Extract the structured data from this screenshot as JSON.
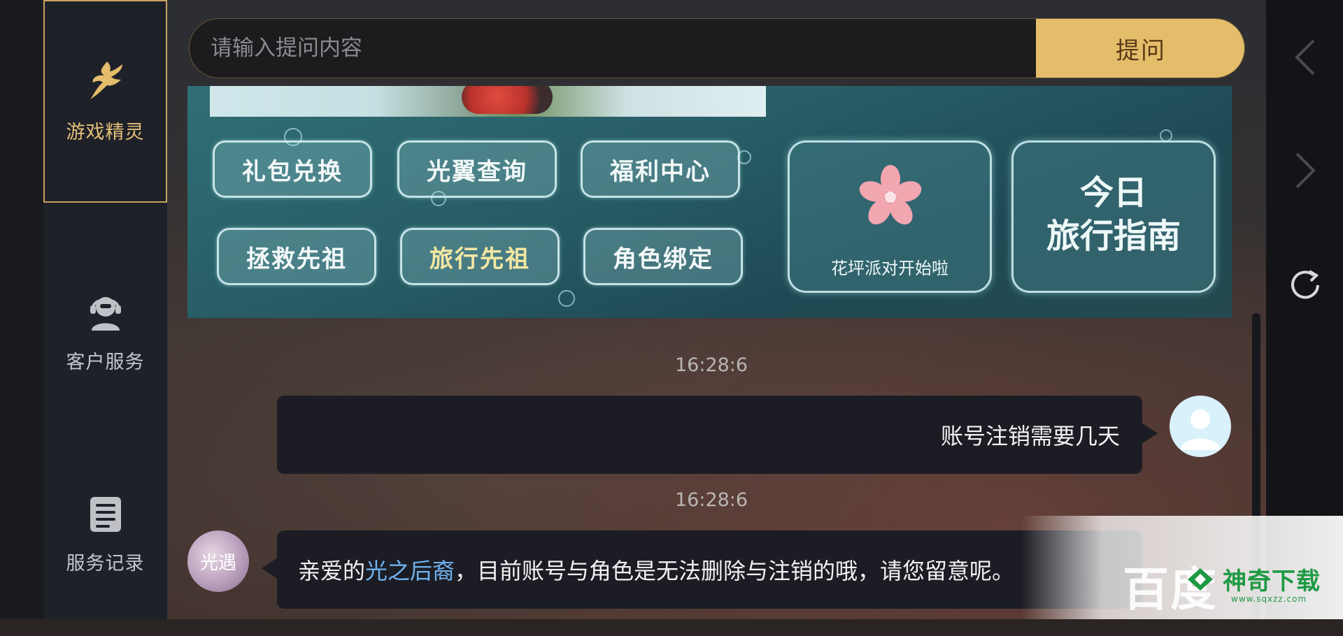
{
  "sidebar": {
    "items": [
      {
        "label": "游戏精灵",
        "icon": "fairy-icon",
        "active": true
      },
      {
        "label": "客户服务",
        "icon": "customer-service-icon",
        "active": false
      },
      {
        "label": "服务记录",
        "icon": "record-icon",
        "active": false
      }
    ]
  },
  "search": {
    "placeholder": "请输入提问内容",
    "value": "",
    "button_label": "提问"
  },
  "banner": {
    "buttons": [
      {
        "label": "礼包兑换"
      },
      {
        "label": "光翼查询"
      },
      {
        "label": "福利中心"
      },
      {
        "label": "拯救先祖"
      },
      {
        "label": "旅行先祖"
      },
      {
        "label": "角色绑定"
      }
    ],
    "card_left_caption": "花坪派对开始啦",
    "card_right_title_line1": "今日",
    "card_right_title_line2": "旅行指南"
  },
  "chat": {
    "messages": [
      {
        "time": "16:28:6",
        "from": "user",
        "text": "账号注销需要几天"
      },
      {
        "time": "16:28:6",
        "from": "bot",
        "text_before": "亲爱的",
        "highlight": "光之后裔",
        "text_after": "，目前账号与角色是无法删除与注销的哦，请您留意呢。"
      }
    ],
    "bot_avatar_text": "光遇"
  },
  "watermark": {
    "text": "百度",
    "brand": "神奇下载",
    "url": "www.sqxzz.com"
  },
  "colors": {
    "accent": "#e4bd6b",
    "sidebar_active_border": "#c9a35f",
    "highlight": "#6fb2f0"
  }
}
